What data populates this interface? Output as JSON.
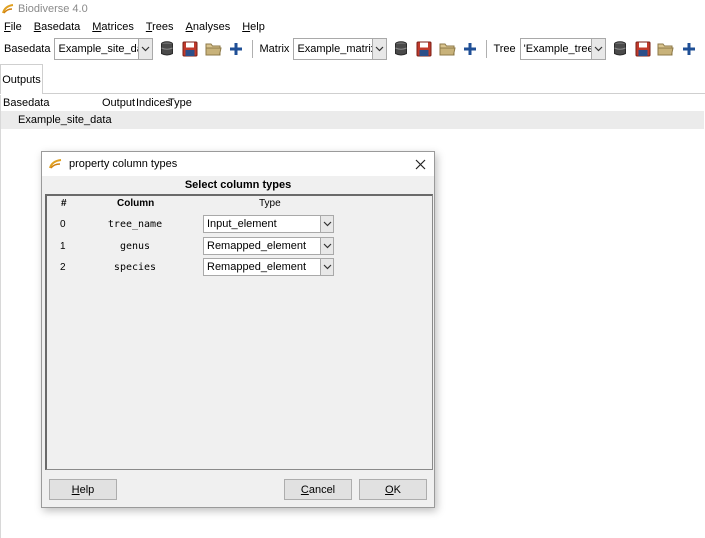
{
  "window": {
    "title": "Biodiverse 4.0"
  },
  "menu": [
    {
      "mnemonic": "F",
      "rest": "ile"
    },
    {
      "mnemonic": "B",
      "rest": "asedata"
    },
    {
      "mnemonic": "M",
      "rest": "atrices"
    },
    {
      "mnemonic": "T",
      "rest": "rees"
    },
    {
      "mnemonic": "A",
      "rest": "nalyses"
    },
    {
      "mnemonic": "H",
      "rest": "elp"
    }
  ],
  "toolbar": {
    "basedata_label": "Basedata",
    "basedata_value": "Example_site_data",
    "matrix_label": "Matrix",
    "matrix_value": "Example_matrix",
    "tree_label": "Tree",
    "tree_value": "'Example_tree'"
  },
  "tabs": {
    "outputs": "Outputs"
  },
  "outputs": {
    "columns": [
      "Basedata",
      "Output",
      "Indices",
      "Type"
    ],
    "rows": [
      "Example_site_data"
    ]
  },
  "dialog": {
    "title": "property column types",
    "heading": "Select column types",
    "headers": {
      "index": "#",
      "column": "Column",
      "type": "Type"
    },
    "rows": [
      {
        "index": "0",
        "column": "tree_name",
        "type": "Input_element"
      },
      {
        "index": "1",
        "column": "genus",
        "type": "Remapped_element"
      },
      {
        "index": "2",
        "column": "species",
        "type": "Remapped_element"
      }
    ],
    "help": {
      "mnemonic": "H",
      "rest": "elp"
    },
    "cancel": {
      "mnemonic": "C",
      "rest": "ancel"
    },
    "ok": {
      "mnemonic": "O",
      "rest": "K"
    }
  },
  "colors": {
    "accent_blue": "#1f4f96",
    "save_red": "#c0392b",
    "folder_tan": "#c8b27a",
    "db_gray": "#4a4a4a"
  }
}
